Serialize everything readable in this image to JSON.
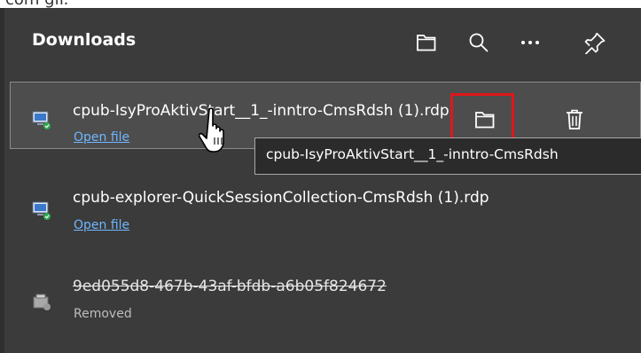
{
  "top_fragment": "com gif.",
  "panel": {
    "title": "Downloads",
    "toolbar": {
      "open_folder_icon": "folder-icon",
      "search_icon": "search-icon",
      "more_icon": "more-options-icon",
      "pin_icon": "pin-icon"
    }
  },
  "downloads": [
    {
      "name": "cpub-IsyProAktivStart__1_-inntro-CmsRdsh (1).rdp",
      "action": "Open file",
      "state": "hovered"
    },
    {
      "name": "cpub-explorer-QuickSessionCollection-CmsRdsh (1).rdp",
      "action": "Open file",
      "state": "normal"
    },
    {
      "name": "9ed055d8-467b-43af-bfdb-a6b05f824672",
      "status": "Removed",
      "state": "removed"
    }
  ],
  "tooltip": {
    "text": "cpub-IsyProAktivStart__1_-inntro-CmsRdsh"
  },
  "colors": {
    "panel_bg": "#3b3b3b",
    "hover_bg": "#4d4d4d",
    "link": "#6fb6ff",
    "highlight": "#e0161b"
  }
}
